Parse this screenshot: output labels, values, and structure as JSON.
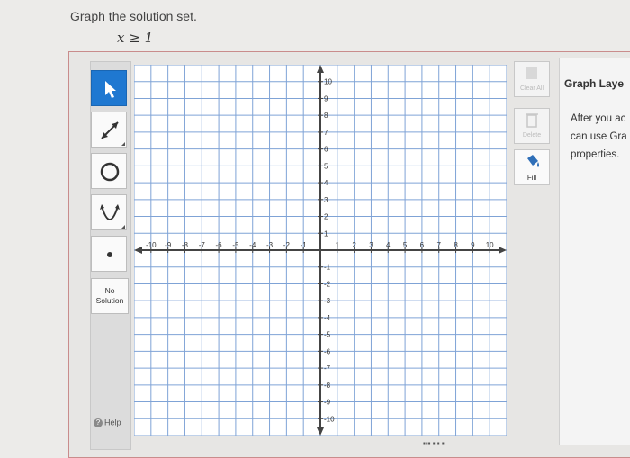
{
  "question": {
    "prompt": "Graph the solution set.",
    "inequality": "x ≥ 1"
  },
  "toolbar": {
    "tools": [
      {
        "name": "select-arrow-icon"
      },
      {
        "name": "line-tool-icon"
      },
      {
        "name": "circle-tool-icon"
      },
      {
        "name": "parabola-tool-icon"
      },
      {
        "name": "point-tool-icon"
      }
    ],
    "no_solution_line1": "No",
    "no_solution_line2": "Solution",
    "help_label": "Help"
  },
  "graph": {
    "x_min": -11,
    "x_max": 11,
    "y_min": -11,
    "y_max": 11,
    "grid": true,
    "x_ticks": [
      "-10",
      "-9",
      "-8",
      "-7",
      "-6",
      "-5",
      "-4",
      "-3",
      "-2",
      "-1",
      "1",
      "2",
      "3",
      "4",
      "5",
      "6",
      "7",
      "8",
      "9",
      "10"
    ],
    "y_ticks": [
      "10",
      "9",
      "8",
      "7",
      "6",
      "5",
      "4",
      "3",
      "2",
      "1",
      "-1",
      "-2",
      "-3",
      "-4",
      "-5",
      "-6",
      "-7",
      "-8",
      "-9",
      "-10"
    ],
    "colors": {
      "grid": "#7fa3d6",
      "axis": "#444444",
      "tool_active": "#1f78d1"
    }
  },
  "right_tools": {
    "clear_all": "Clear All",
    "delete": "Delete",
    "fill": "Fill"
  },
  "panel": {
    "title": "Graph Laye",
    "line1": "After you ac",
    "line2": "can use Gra",
    "line3": "properties."
  }
}
